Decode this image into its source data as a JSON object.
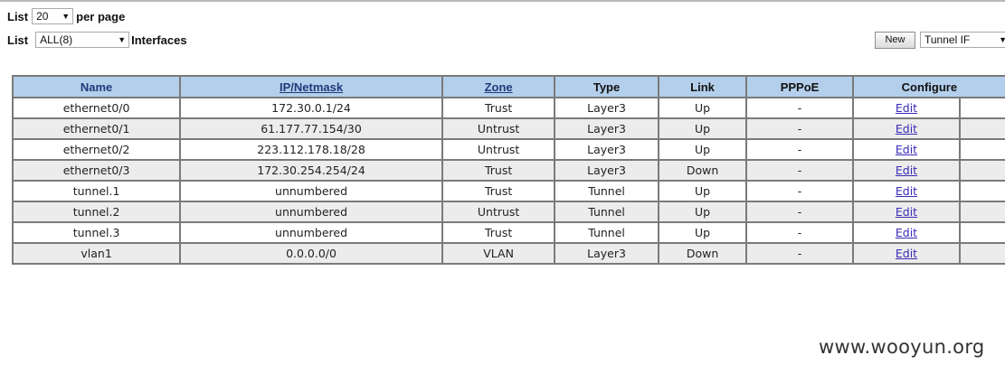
{
  "paging": {
    "list_label": "List",
    "per_page_value": "20",
    "per_page_suffix": "per page"
  },
  "filter": {
    "list_label": "List",
    "interfaces_value": "ALL(8)",
    "interfaces_suffix": "Interfaces"
  },
  "toolbar": {
    "new_label": "New",
    "type_select_value": "Tunnel IF"
  },
  "table": {
    "headers": {
      "name": "Name",
      "ip": "IP/Netmask",
      "zone": "Zone",
      "type": "Type",
      "link": "Link",
      "pppoe": "PPPoE",
      "configure": "Configure"
    },
    "rows": [
      {
        "name": "ethernet0/0",
        "ip": "172.30.0.1/24",
        "zone": "Trust",
        "type": "Layer3",
        "link": "Up",
        "pppoe": "-",
        "action": "Edit"
      },
      {
        "name": "ethernet0/1",
        "ip": "61.177.77.154/30",
        "zone": "Untrust",
        "type": "Layer3",
        "link": "Up",
        "pppoe": "-",
        "action": "Edit"
      },
      {
        "name": "ethernet0/2",
        "ip": "223.112.178.18/28",
        "zone": "Untrust",
        "type": "Layer3",
        "link": "Up",
        "pppoe": "-",
        "action": "Edit"
      },
      {
        "name": "ethernet0/3",
        "ip": "172.30.254.254/24",
        "zone": "Trust",
        "type": "Layer3",
        "link": "Down",
        "pppoe": "-",
        "action": "Edit"
      },
      {
        "name": "tunnel.1",
        "ip": "unnumbered",
        "zone": "Trust",
        "type": "Tunnel",
        "link": "Up",
        "pppoe": "-",
        "action": "Edit"
      },
      {
        "name": "tunnel.2",
        "ip": "unnumbered",
        "zone": "Untrust",
        "type": "Tunnel",
        "link": "Up",
        "pppoe": "-",
        "action": "Edit"
      },
      {
        "name": "tunnel.3",
        "ip": "unnumbered",
        "zone": "Trust",
        "type": "Tunnel",
        "link": "Up",
        "pppoe": "-",
        "action": "Edit"
      },
      {
        "name": "vlan1",
        "ip": "0.0.0.0/0",
        "zone": "VLAN",
        "type": "Layer3",
        "link": "Down",
        "pppoe": "-",
        "action": "Edit"
      }
    ]
  },
  "watermark": "www.wooyun.org",
  "colors": {
    "header_bg": "#b3cfeb",
    "shaded_row_bg": "#ececec",
    "link": "#3a2bb5"
  }
}
